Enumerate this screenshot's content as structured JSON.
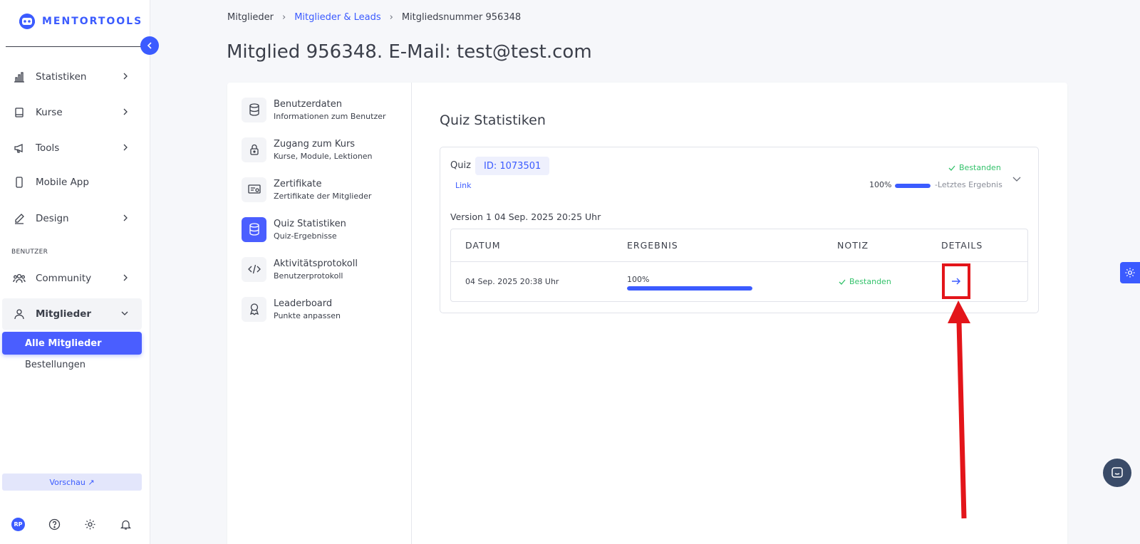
{
  "app": {
    "logo_text": "MENTORTOOLS"
  },
  "sidebar": {
    "items": [
      {
        "label": "Statistiken",
        "icon": "bar-chart-icon"
      },
      {
        "label": "Kurse",
        "icon": "book-icon"
      },
      {
        "label": "Tools",
        "icon": "megaphone-icon"
      },
      {
        "label": "Mobile App",
        "icon": "phone-icon"
      },
      {
        "label": "Design",
        "icon": "pencil-icon"
      }
    ],
    "section_label": "BENUTZER",
    "community_label": "Community",
    "members_label": "Mitglieder",
    "sub_items": [
      "Alle Mitglieder",
      "Bestellungen"
    ],
    "preview_label": "Vorschau ↗",
    "avatar_initials": "RP"
  },
  "breadcrumb": {
    "items": [
      "Mitglieder",
      "Mitglieder & Leads",
      "Mitgliedsnummer 956348"
    ]
  },
  "page_title": "Mitglied 956348. E-Mail: test@test.com",
  "tabs": [
    {
      "title": "Benutzerdaten",
      "subtitle": "Informationen zum Benutzer"
    },
    {
      "title": "Zugang zum Kurs",
      "subtitle": "Kurse, Module, Lektionen"
    },
    {
      "title": "Zertifikate",
      "subtitle": "Zertifikate der Mitglieder"
    },
    {
      "title": "Quiz Statistiken",
      "subtitle": "Quiz-Ergebnisse"
    },
    {
      "title": "Aktivitätsprotokoll",
      "subtitle": "Benutzerprotokoll"
    },
    {
      "title": "Leaderboard",
      "subtitle": "Punkte anpassen"
    }
  ],
  "quiz": {
    "section_title": "Quiz Statistiken",
    "label": "Quiz",
    "id_badge": "ID: 1073501",
    "link_label": "Link",
    "status": "Bestanden",
    "score_pct": "100%",
    "score_fraction": 1.0,
    "last_result_label": "-Letztes Ergebnis",
    "version_label": "Version 1 04 Sep. 2025 20:25 Uhr",
    "table": {
      "headers": [
        "DATUM",
        "ERGEBNIS",
        "NOTIZ",
        "DETAILS"
      ],
      "rows": [
        {
          "date": "04 Sep. 2025 20:38 Uhr",
          "result": "100%",
          "result_fraction": 1.0,
          "note": "Bestanden"
        }
      ]
    }
  },
  "colors": {
    "accent": "#3b5bff",
    "success": "#34c26b",
    "annotation": "#e3151a"
  }
}
